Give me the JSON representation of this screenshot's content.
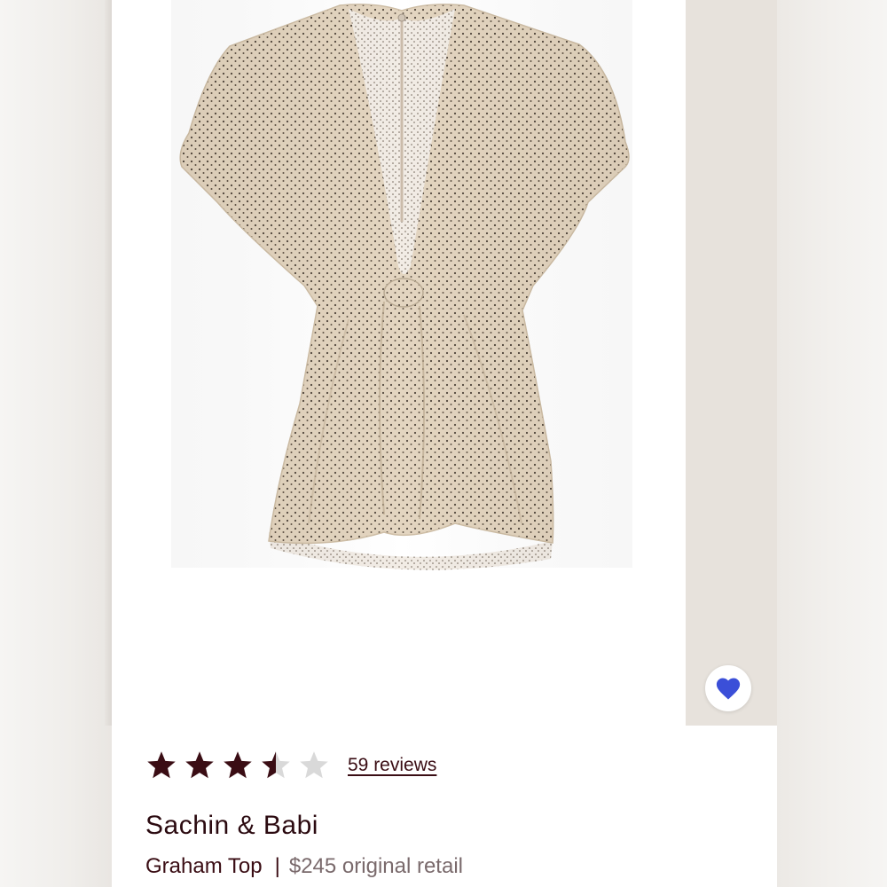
{
  "product": {
    "brand": "Sachin & Babi",
    "name": "Graham Top",
    "separator": "|",
    "price_text": "$245 original retail"
  },
  "rating": {
    "value": 3.5,
    "max": 5,
    "reviews_text": "59 reviews"
  },
  "favorite": {
    "icon": "heart-icon",
    "active": true
  },
  "colors": {
    "star_filled": "#3a0d14",
    "star_empty": "#d9d9d9",
    "heart": "#3b4fd8",
    "brand_text": "#2b0a10"
  }
}
